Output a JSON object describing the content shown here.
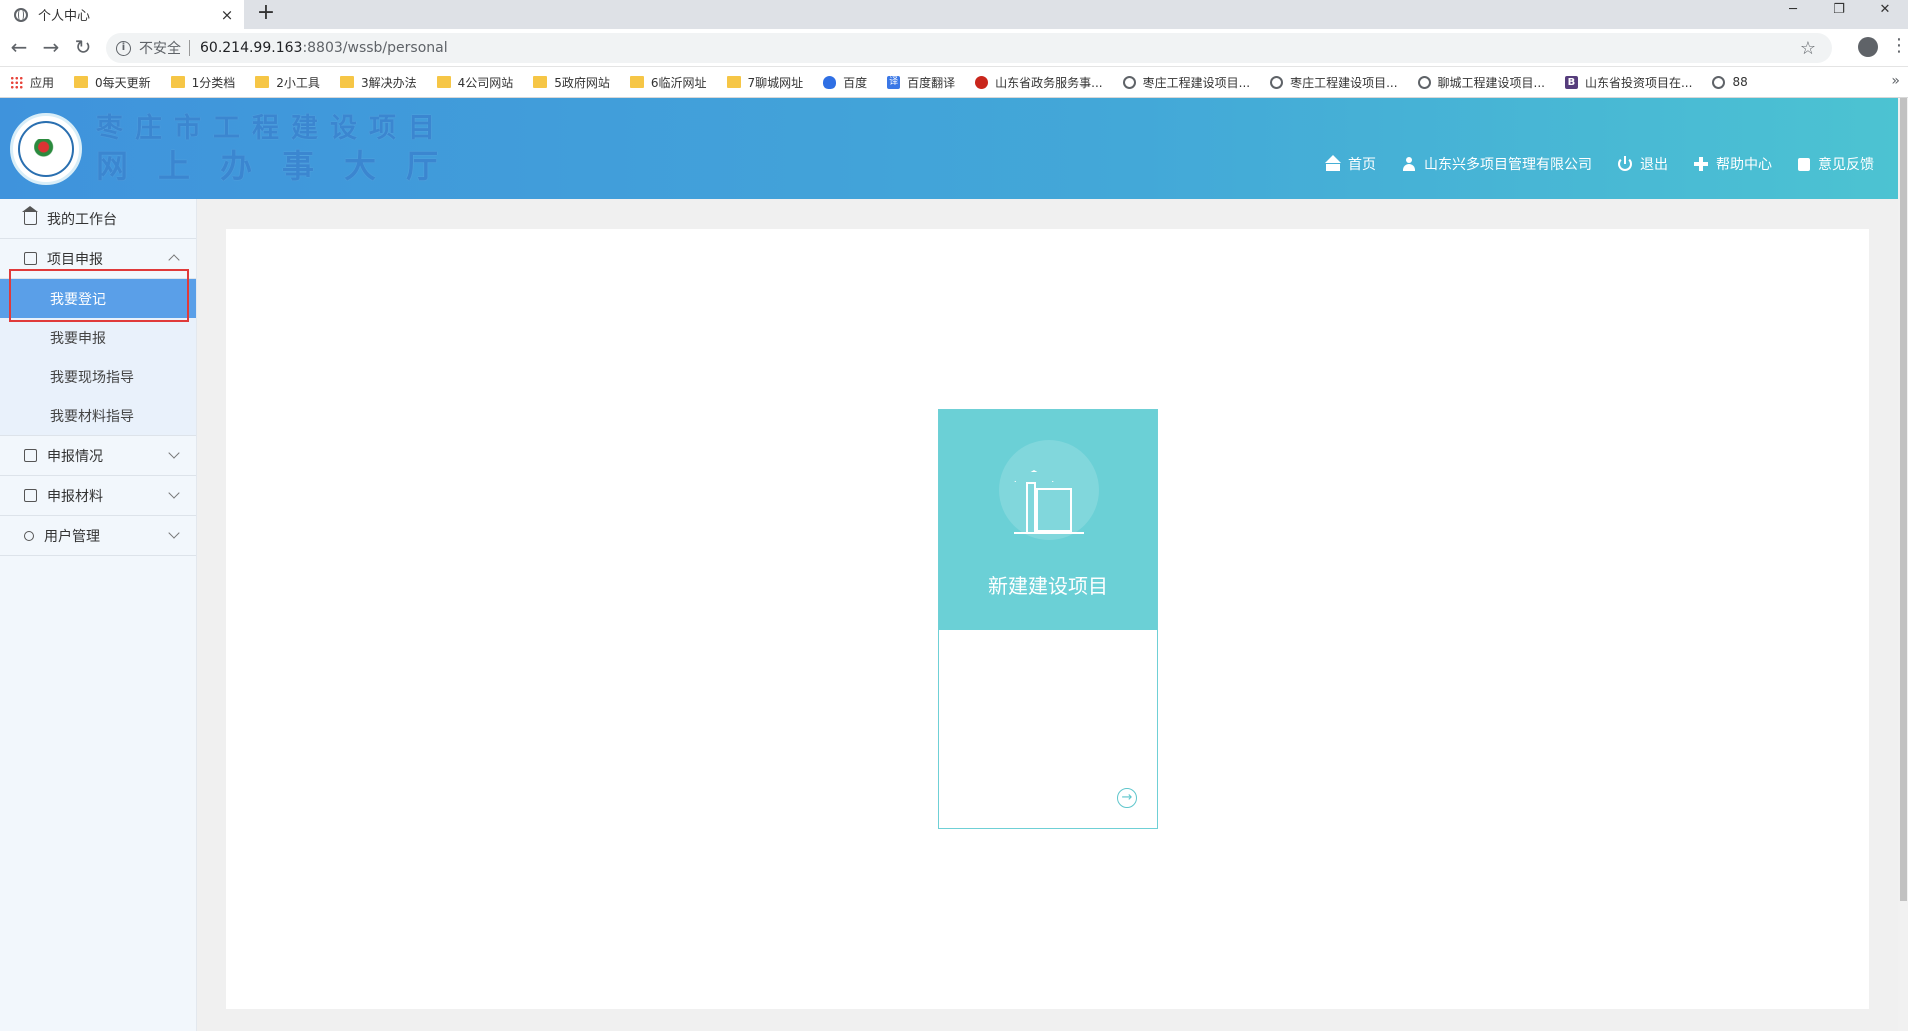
{
  "browser": {
    "tab_title": "个人中心",
    "tab_close": "×",
    "new_tab": "+",
    "window_controls": [
      "─",
      "❐",
      "✕"
    ],
    "nav": {
      "back": "←",
      "forward": "→",
      "reload": "↻"
    },
    "url": {
      "security_label": "不安全",
      "host": "60.214.99.163",
      "path": ":8803/wssb/personal"
    },
    "bookmarks": [
      {
        "label": "应用",
        "icon": "apps-icon"
      },
      {
        "label": "0每天更新",
        "icon": "folder-icon"
      },
      {
        "label": "1分类档",
        "icon": "folder-icon"
      },
      {
        "label": "2小工具",
        "icon": "folder-icon"
      },
      {
        "label": "3解决办法",
        "icon": "folder-icon"
      },
      {
        "label": "4公司网站",
        "icon": "folder-icon"
      },
      {
        "label": "5政府网站",
        "icon": "folder-icon"
      },
      {
        "label": "6临沂网址",
        "icon": "folder-icon"
      },
      {
        "label": "7聊城网址",
        "icon": "folder-icon"
      },
      {
        "label": "百度",
        "icon": "baidu-icon"
      },
      {
        "label": "百度翻译",
        "icon": "fanyi-icon"
      },
      {
        "label": "山东省政务服务事...",
        "icon": "emblem-icon"
      },
      {
        "label": "枣庄工程建设项目...",
        "icon": "globe-icon"
      },
      {
        "label": "枣庄工程建设项目...",
        "icon": "globe-icon"
      },
      {
        "label": "聊城工程建设项目...",
        "icon": "globe-icon"
      },
      {
        "label": "山东省投资项目在...",
        "icon": "b-icon"
      },
      {
        "label": "88",
        "icon": "globe-icon"
      }
    ],
    "bookmarks_more": "»"
  },
  "header": {
    "title_line1": "枣庄市工程建设项目",
    "title_line2": "网上办事大厅",
    "nav": [
      {
        "label": "首页",
        "icon": "home-icon"
      },
      {
        "label": "山东兴多项目管理有限公司",
        "icon": "user-icon"
      },
      {
        "label": "退出",
        "icon": "power-icon"
      },
      {
        "label": "帮助中心",
        "icon": "help-icon"
      },
      {
        "label": "意见反馈",
        "icon": "feedback-icon"
      }
    ]
  },
  "sidebar": {
    "workbench": "我的工作台",
    "project_apply": {
      "label": "项目申报",
      "children": [
        "我要登记",
        "我要申报",
        "我要现场指导",
        "我要材料指导"
      ],
      "active": "我要登记"
    },
    "apply_status": "申报情况",
    "apply_materials": "申报材料",
    "user_manage": "用户管理"
  },
  "main": {
    "card": {
      "label": "新建建设项目",
      "arrow": "→"
    }
  },
  "colors": {
    "header_gradient_start": "#3f93dc",
    "header_gradient_end": "#4cc3d2",
    "sidebar_active": "#5a9fe8",
    "card_teal": "#6bd0d6",
    "highlight_red": "#e03a3a"
  }
}
